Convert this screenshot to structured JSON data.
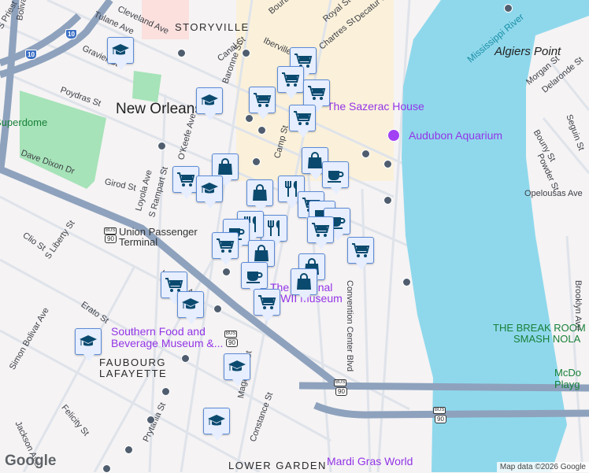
{
  "map": {
    "water_color": "#8fd8ec",
    "land_color": "#f5f3f4",
    "road_color": "#d7dde6",
    "freeway_color": "#8ea2bd",
    "park_color": "#a6e3b8",
    "marker_color": "#0b4a6f",
    "marker_bg": "#e6eeff"
  },
  "labels": {
    "storyville": "STORYVILLE",
    "new_orleans": "New Orleans",
    "superdome": "Superdome",
    "algiers": "Algiers Point",
    "river": "Mississippi River",
    "faubourg1": "FAUBOURG",
    "faubourg2": "LAFAYETTE",
    "lower_garden": "LOWER GARDEN",
    "sazerac": "The Sazerac House",
    "aquarium": "Audubon Aquarium",
    "sofab1": "Southern Food and",
    "sofab2": "Beverage Museum &...",
    "ww2_1": "The National",
    "ww2_2": "WWII Museum",
    "mardi": "Mardi Gras World",
    "break1": "THE BREAK ROOM",
    "break2": "SMASH NOLA",
    "mcd1": "McDo",
    "mcd2": "Playg",
    "union1": "Union Passenger",
    "union2": "Terminal"
  },
  "streets": [
    "Tulane Ave",
    "Gravier St",
    "Canal St",
    "Iberville St",
    "Bourbon St",
    "Royal St",
    "Chartres St",
    "Decatur St",
    "Poydras St",
    "Dave Dixon Dr",
    "Girod St",
    "Loyola Ave",
    "S Rampart St",
    "O'Keefe Ave",
    "Baronne St",
    "Camp St",
    "Clio St",
    "S Liberty St",
    "Erato St",
    "Howard Ave",
    "Simon Bolivar Ave",
    "Felicity St",
    "Jackson Ave",
    "Prytania St",
    "Magazine St",
    "Constance St",
    "Convention Center Blvd",
    "Morgan St",
    "Delaronde St",
    "Bouny St",
    "Powder St",
    "Seguin St",
    "Brooklyn Ave",
    "Opelousas Ave",
    "Bolivar St",
    "Cleveland Ave",
    "S Priest St"
  ],
  "shields": {
    "i10": "10",
    "bus": "BUS",
    "us90": "90"
  },
  "attribution": "Map data ©2026 Google",
  "logo": "Google",
  "markers": [
    {
      "type": "school",
      "icon": "graduation-cap-icon"
    },
    {
      "type": "school",
      "icon": "graduation-cap-icon"
    },
    {
      "type": "cart",
      "icon": "shopping-cart-icon"
    },
    {
      "type": "cart",
      "icon": "shopping-cart-icon"
    },
    {
      "type": "cart",
      "icon": "shopping-cart-icon"
    },
    {
      "type": "cart",
      "icon": "shopping-cart-icon"
    },
    {
      "type": "cart",
      "icon": "shopping-cart-icon"
    },
    {
      "type": "shop",
      "icon": "shopping-bag-icon"
    },
    {
      "type": "cart",
      "icon": "shopping-cart-icon"
    },
    {
      "type": "school",
      "icon": "graduation-cap-icon"
    },
    {
      "type": "shop",
      "icon": "shopping-bag-icon"
    },
    {
      "type": "cup",
      "icon": "coffee-cup-icon"
    },
    {
      "type": "shop",
      "icon": "shopping-bag-icon"
    },
    {
      "type": "food",
      "icon": "restaurant-icon"
    },
    {
      "type": "cart",
      "icon": "shopping-cart-icon"
    },
    {
      "type": "cup",
      "icon": "coffee-cup-icon"
    },
    {
      "type": "cup",
      "icon": "coffee-cup-icon"
    },
    {
      "type": "food",
      "icon": "restaurant-icon"
    },
    {
      "type": "food",
      "icon": "restaurant-icon"
    },
    {
      "type": "cup",
      "icon": "coffee-cup-icon"
    },
    {
      "type": "cart",
      "icon": "shopping-cart-icon"
    },
    {
      "type": "cart",
      "icon": "shopping-cart-icon"
    },
    {
      "type": "shop",
      "icon": "shopping-bag-icon"
    },
    {
      "type": "cart",
      "icon": "shopping-cart-icon"
    },
    {
      "type": "shop",
      "icon": "shopping-bag-icon"
    },
    {
      "type": "cup",
      "icon": "coffee-cup-icon"
    },
    {
      "type": "shop",
      "icon": "shopping-bag-icon"
    },
    {
      "type": "cart",
      "icon": "shopping-cart-icon"
    },
    {
      "type": "school",
      "icon": "graduation-cap-icon"
    },
    {
      "type": "cart",
      "icon": "shopping-cart-icon"
    },
    {
      "type": "school",
      "icon": "graduation-cap-icon"
    },
    {
      "type": "school",
      "icon": "graduation-cap-icon"
    },
    {
      "type": "school",
      "icon": "graduation-cap-icon"
    }
  ]
}
